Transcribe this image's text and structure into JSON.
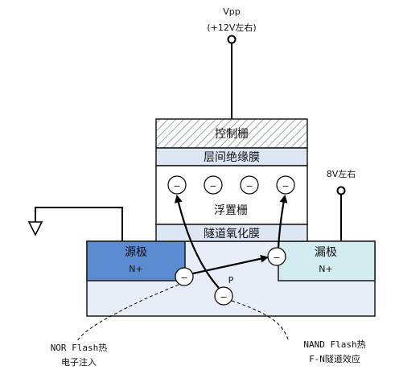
{
  "vpp": {
    "label": "Vpp",
    "sub": "(+12V左右)"
  },
  "layers": {
    "control_gate": "控制栅",
    "interlayer": "层间绝缘膜",
    "floating_gate": "浮置栅",
    "tunnel_oxide": "隧道氧化膜"
  },
  "source": {
    "label": "源极",
    "doping": "N+"
  },
  "drain": {
    "label": "漏极",
    "doping": "N+",
    "voltage": "8V左右"
  },
  "substrate": {
    "label": "P"
  },
  "electron_symbol": "−",
  "annotations": {
    "nor_line1": "NOR Flash热",
    "nor_line2": "电子注入",
    "nand_line1": "NAND Flash热",
    "nand_line2": "F-N隧道效应"
  },
  "colors": {
    "source_fill": "#5b8bd0",
    "drain_fill": "#d3ecef",
    "substrate_fill": "#e8eef8",
    "gate_stack_fill": "#dde6f3",
    "floating_fill": "#ffffff",
    "stroke": "#1a1a1a"
  }
}
